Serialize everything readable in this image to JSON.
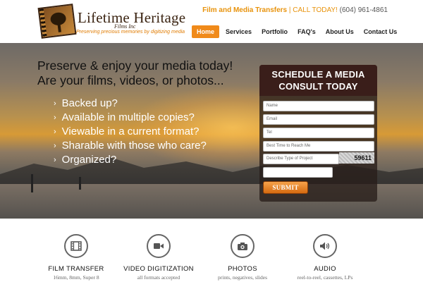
{
  "header": {
    "logo_title": "Lifetime Heritage",
    "logo_subtitle": "Films Inc",
    "logo_tagline": "Preserving precious memories by digitizing media",
    "contact_label": "Film and Media Transfers",
    "contact_separator": "|",
    "contact_call": "CALL TODAY!",
    "contact_phone": "(604) 961-4861"
  },
  "nav": {
    "items": [
      {
        "label": "Home",
        "active": true
      },
      {
        "label": "Services",
        "active": false
      },
      {
        "label": "Portfolio",
        "active": false
      },
      {
        "label": "FAQ's",
        "active": false
      },
      {
        "label": "About Us",
        "active": false
      },
      {
        "label": "Contact Us",
        "active": false
      }
    ]
  },
  "hero": {
    "headline_line1": "Preserve & enjoy your media today!",
    "headline_line2": "Are your films, videos, or photos...",
    "bullets": [
      "Backed up?",
      "Available in multiple copies?",
      "Viewable in a current format?",
      "Sharable with those who care?",
      "Organized?"
    ]
  },
  "form": {
    "title_line1": "SCHEDULE A MEDIA",
    "title_line2": "CONSULT TODAY",
    "name_placeholder": "Name",
    "email_placeholder": "Email",
    "tel_placeholder": "Tel",
    "time_placeholder": "Best Time to Reach Me",
    "project_placeholder": "Describe Type of Project",
    "captcha_code": "59611",
    "submit_label": "SUBMIT"
  },
  "services": [
    {
      "title": "FILM TRANSFER",
      "subtitle": "16mm, 8mm, Super 8",
      "icon": "film-icon"
    },
    {
      "title": "VIDEO DIGITIZATION",
      "subtitle": "all formats accepted",
      "icon": "video-camera-icon"
    },
    {
      "title": "PHOTOS",
      "subtitle": "prints, negatives, slides",
      "icon": "camera-icon"
    },
    {
      "title": "AUDIO",
      "subtitle": "reel-to-reel, cassettes, LPs",
      "icon": "speaker-icon"
    }
  ],
  "colors": {
    "accent_orange": "#f08a1a",
    "form_header": "#3a1e1a",
    "logo_brown": "#3b2412"
  }
}
